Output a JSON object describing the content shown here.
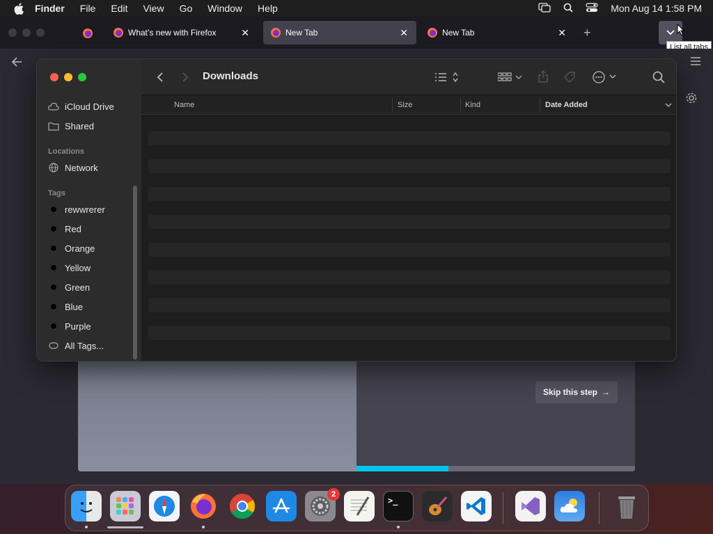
{
  "menubar": {
    "app_name": "Finder",
    "items": [
      "File",
      "Edit",
      "View",
      "Go",
      "Window",
      "Help"
    ],
    "datetime": "Mon Aug 14  1:58 PM"
  },
  "browser": {
    "tabs": [
      {
        "label": "What’s new with Firefox",
        "active": false
      },
      {
        "label": "New Tab",
        "active": true
      },
      {
        "label": "New Tab",
        "active": false
      }
    ],
    "tooltip": "List all tabs",
    "skip_label": "Skip this step",
    "skip_arrow": "→",
    "progress": 0.33,
    "accent": "#00c5ed"
  },
  "finder": {
    "title": "Downloads",
    "sidebar": {
      "favorites": [
        {
          "label": "iCloud Drive",
          "icon": "cloud-icon"
        },
        {
          "label": "Shared",
          "icon": "shared-folder-icon"
        }
      ],
      "locations_heading": "Locations",
      "locations": [
        {
          "label": "Network",
          "icon": "globe-icon"
        }
      ],
      "tags_heading": "Tags",
      "tags": [
        "rewwrerer",
        "Red",
        "Orange",
        "Yellow",
        "Green",
        "Blue",
        "Purple"
      ],
      "all_tags": "All Tags..."
    },
    "columns": {
      "name": "Name",
      "size": "Size",
      "kind": "Kind",
      "date_added": "Date Added"
    }
  },
  "dock": {
    "apps": [
      "Finder",
      "Launchpad",
      "Safari",
      "Firefox",
      "Chrome",
      "App Store",
      "System Settings",
      "TextEdit",
      "Terminal",
      "GarageBand",
      "Visual Studio Code",
      "Visual Studio",
      "Weather",
      "Trash"
    ],
    "settings_badge": "2",
    "terminal_prompt": ">_"
  }
}
